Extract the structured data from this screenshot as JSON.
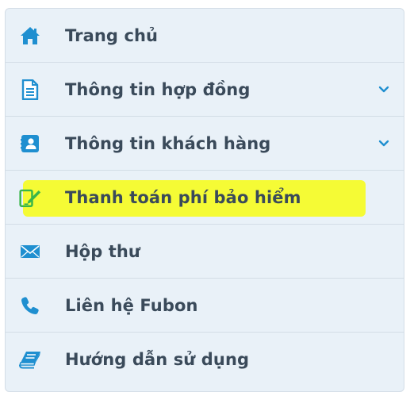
{
  "menu": {
    "items": [
      {
        "label": "Trang chủ",
        "icon": "home-icon",
        "has_submenu": false
      },
      {
        "label": "Thông tin hợp đồng",
        "icon": "document-icon",
        "has_submenu": true
      },
      {
        "label": "Thông tin khách hàng",
        "icon": "contact-card-icon",
        "has_submenu": true
      },
      {
        "label": "Thanh toán phí bảo hiểm",
        "icon": "mobile-payment-icon",
        "has_submenu": false,
        "highlighted": true
      },
      {
        "label": "Hộp thư",
        "icon": "envelope-icon",
        "has_submenu": false
      },
      {
        "label": "Liên hệ Fubon",
        "icon": "phone-icon",
        "has_submenu": false
      },
      {
        "label": "Hướng dẫn sử dụng",
        "icon": "book-icon",
        "has_submenu": false
      }
    ]
  },
  "colors": {
    "panel_background": "#e9f1f8",
    "divider": "#d3dde6",
    "label_text": "#3a4a5a",
    "icon_blue": "#1f8fd0",
    "highlight": "#f6fb2a",
    "payment_icon_green": "#39b54a"
  }
}
